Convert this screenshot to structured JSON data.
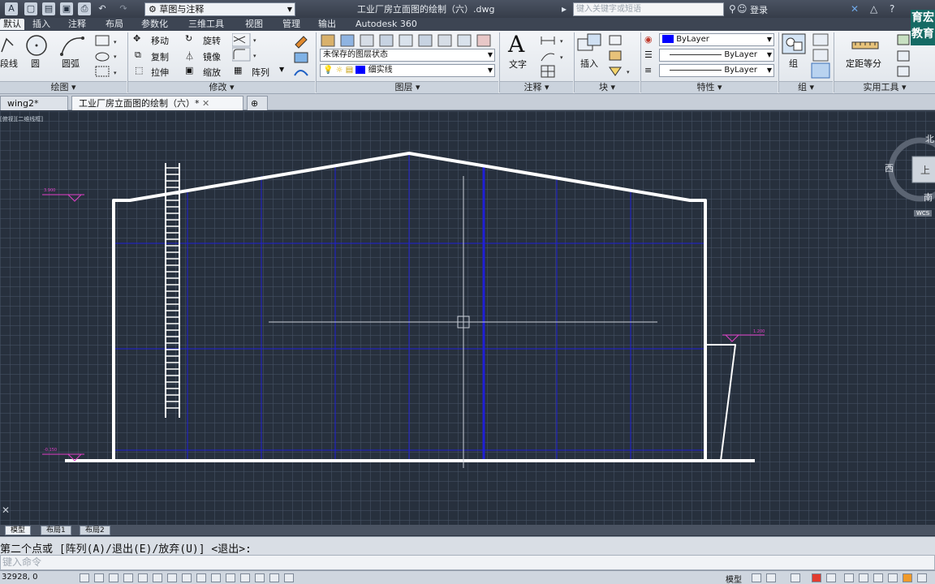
{
  "titlebar": {
    "workspace": "草图与注释",
    "document_title": "工业厂房立面图的绘制（六）.dwg",
    "search_placeholder": "键入关键字或短语",
    "login_label": "登录"
  },
  "tabs": [
    "默认",
    "插入",
    "注释",
    "布局",
    "参数化",
    "三维工具",
    "视图",
    "管理",
    "输出",
    "Autodesk 360"
  ],
  "ribbon": {
    "draw": {
      "title": "绘图",
      "polyline": "段线",
      "circle": "圆",
      "arc": "圆弧"
    },
    "modify": {
      "title": "修改",
      "move": "移动",
      "rotate": "旋转",
      "copy": "复制",
      "mirror": "镜像",
      "stretch": "拉伸",
      "scale": "缩放",
      "array": "阵列"
    },
    "layers": {
      "title": "图层",
      "layer_state": "未保存的图层状态",
      "current_layer": "细实线"
    },
    "annotation": {
      "title": "注释",
      "text": "文字"
    },
    "block": {
      "title": "块",
      "insert": "插入"
    },
    "properties": {
      "title": "特性",
      "color": "ByLayer",
      "linetype": "ByLayer",
      "lineweight": "ByLayer"
    },
    "groups": {
      "title": "组",
      "group": "组"
    },
    "utilities": {
      "title": "实用工具",
      "measure": "定距等分"
    }
  },
  "file_tabs": [
    "wing2*",
    "工业厂房立面图的绘制（六）*"
  ],
  "viewport_label": "[俯视][二维线框]",
  "drawing": {
    "elevation_left_top": "3.900",
    "elevation_left_bottom": "-0.150",
    "elevation_right": "1.200"
  },
  "viewcube": {
    "north": "北",
    "west": "西",
    "south": "南",
    "top_face": "上",
    "wcs": "WCS"
  },
  "layout_tabs": [
    "模型",
    "布局1",
    "布局2"
  ],
  "command": {
    "history": "第二个点或 [阵列(A)/退出(E)/放弃(U)] <退出>:",
    "input_placeholder": "键入命令"
  },
  "status": {
    "coords": "32928, 0",
    "space": "模型"
  },
  "watermark": "育宏教育",
  "colors": {
    "canvas": "#27303d",
    "layer_blue": "#0000ff",
    "elevation_magenta": "#e040c8",
    "accent": "#1d5fc4"
  }
}
